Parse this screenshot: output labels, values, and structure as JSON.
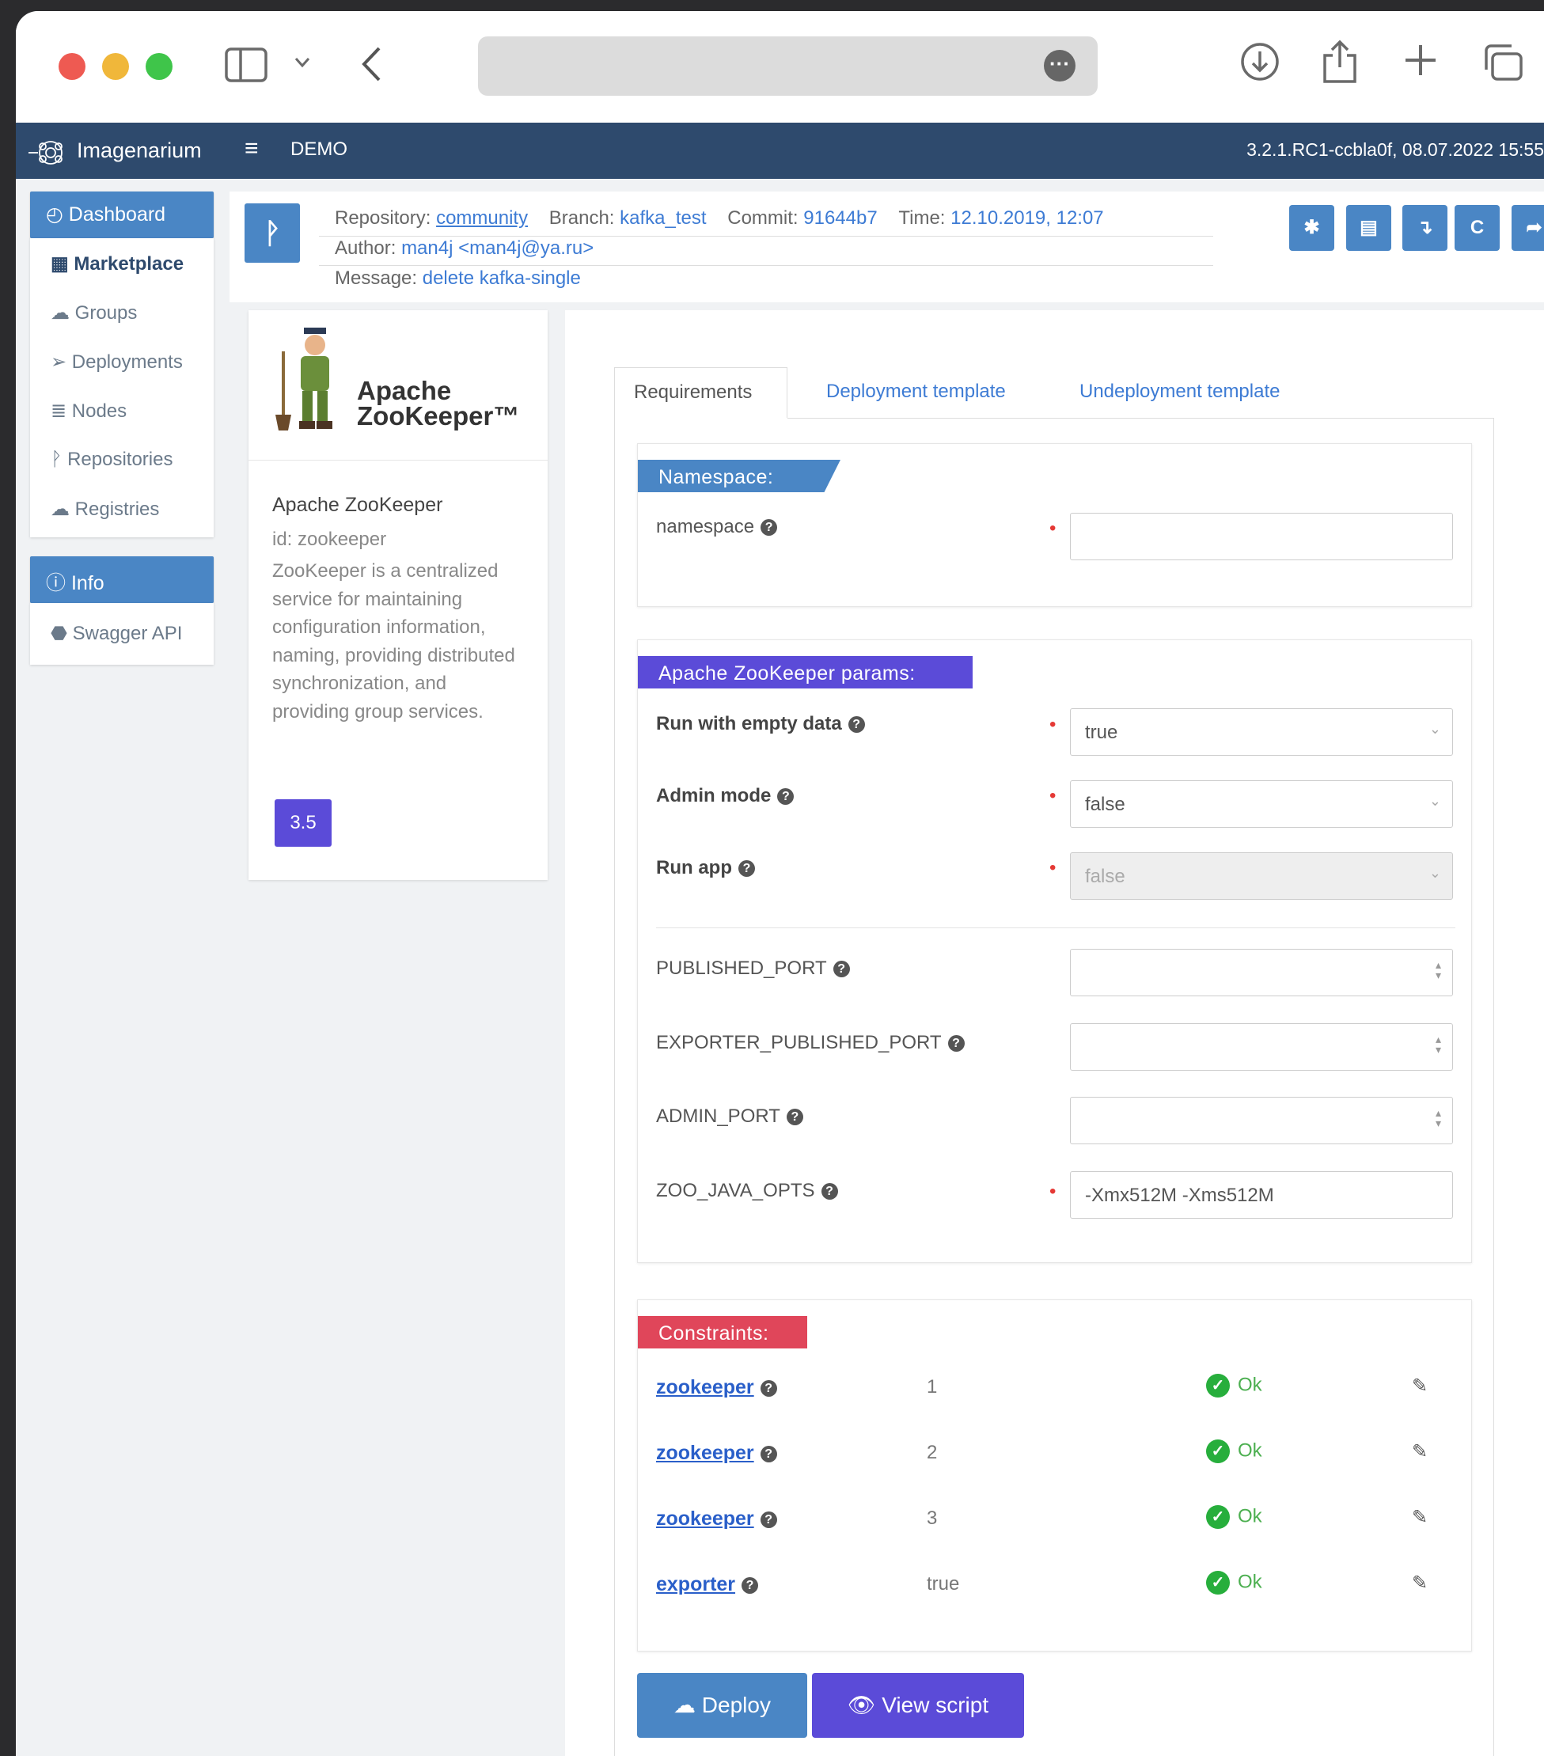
{
  "app": {
    "brand": "Imagenarium",
    "env": "DEMO",
    "version": "3.2.1.RC1-ccbla0f, 08.07.2022 15:55"
  },
  "sidebar": {
    "dashboard": "Dashboard",
    "items": [
      {
        "label": "Marketplace",
        "icon": "grid-icon"
      },
      {
        "label": "Groups",
        "icon": "groups-icon"
      },
      {
        "label": "Deployments",
        "icon": "paper-plane-icon"
      },
      {
        "label": "Nodes",
        "icon": "list-icon"
      },
      {
        "label": "Repositories",
        "icon": "branch-icon"
      },
      {
        "label": "Registries",
        "icon": "cloud-icon"
      }
    ],
    "info": "Info",
    "swagger": "Swagger API"
  },
  "repo": {
    "repository_label": "Repository:",
    "repository": "community",
    "branch_label": "Branch:",
    "branch": "kafka_test",
    "commit_label": "Commit:",
    "commit": "91644b7",
    "time_label": "Time:",
    "time": "12.10.2019, 12:07",
    "author_label": "Author:",
    "author": "man4j <man4j@ya.ru>",
    "message_label": "Message:",
    "message": "delete kafka-single"
  },
  "card": {
    "logo_title_1": "Apache",
    "logo_title_2": "ZooKeeper™",
    "name": "Apache ZooKeeper",
    "id": "id: zookeeper",
    "description": "ZooKeeper is a centralized service for maintaining configuration information, naming, providing distributed synchronization, and providing group services.",
    "version": "3.5"
  },
  "tabs": {
    "requirements": "Requirements",
    "deployment": "Deployment template",
    "undeployment": "Undeployment template"
  },
  "namespace": {
    "header": "Namespace:",
    "label": "namespace",
    "value": ""
  },
  "params": {
    "header": "Apache ZooKeeper params:",
    "run_empty": {
      "label": "Run with empty data",
      "value": "true"
    },
    "admin_mode": {
      "label": "Admin mode",
      "value": "false"
    },
    "run_app": {
      "label": "Run app",
      "value": "false"
    },
    "published_port": {
      "label": "PUBLISHED_PORT",
      "value": ""
    },
    "exporter_port": {
      "label": "EXPORTER_PUBLISHED_PORT",
      "value": ""
    },
    "admin_port": {
      "label": "ADMIN_PORT",
      "value": ""
    },
    "java_opts": {
      "label": "ZOO_JAVA_OPTS",
      "value": "-Xmx512M -Xms512M"
    }
  },
  "constraints": {
    "header": "Constraints:",
    "rows": [
      {
        "name": "zookeeper",
        "value": "1",
        "status": "Ok"
      },
      {
        "name": "zookeeper",
        "value": "2",
        "status": "Ok"
      },
      {
        "name": "zookeeper",
        "value": "3",
        "status": "Ok"
      },
      {
        "name": "exporter",
        "value": "true",
        "status": "Ok"
      }
    ]
  },
  "actions": {
    "deploy": "Deploy",
    "view_script": "View script"
  },
  "colors": {
    "appbar": "#2e4a6d",
    "primary": "#4a86c5",
    "namespace_head": "#4a86c5",
    "params_head": "#5b4bd8",
    "constraints_head": "#e0465a",
    "ok": "#27ae3c"
  }
}
